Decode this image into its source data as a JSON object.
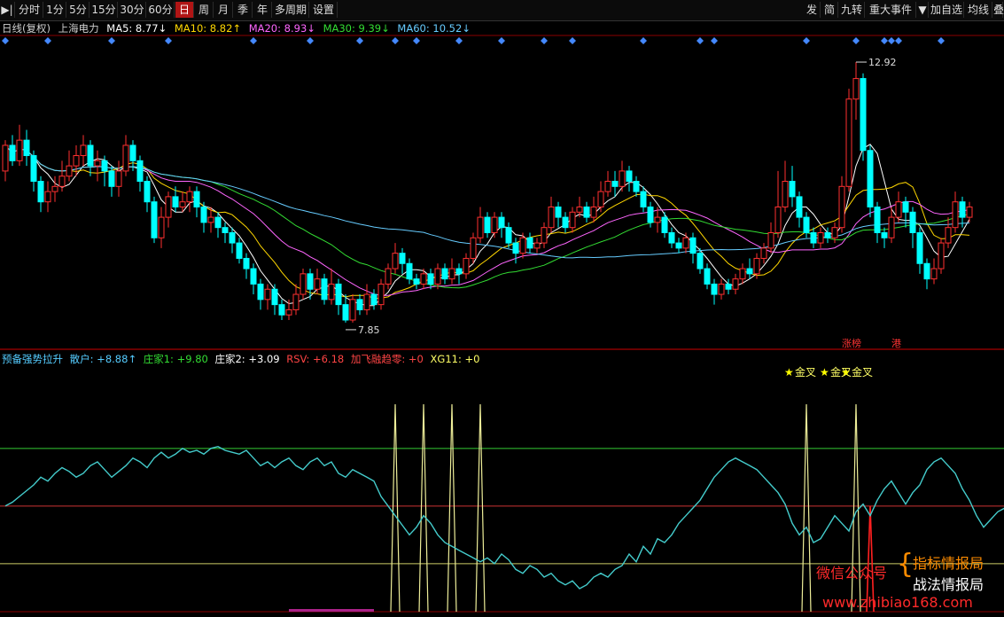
{
  "toolbar": {
    "left": [
      {
        "label": "▶|",
        "active": false
      },
      {
        "label": "分时",
        "active": false
      },
      {
        "label": "1分",
        "active": false
      },
      {
        "label": "5分",
        "active": false
      },
      {
        "label": "15分",
        "active": false
      },
      {
        "label": "30分",
        "active": false
      },
      {
        "label": "60分",
        "active": false
      },
      {
        "label": "日",
        "active": true
      },
      {
        "label": "周",
        "active": false
      },
      {
        "label": "月",
        "active": false
      },
      {
        "label": "季",
        "active": false
      },
      {
        "label": "年",
        "active": false
      },
      {
        "label": "多周期",
        "active": false
      },
      {
        "label": "设置",
        "active": false
      }
    ],
    "right": [
      "发",
      "简",
      "九转",
      "重大事件",
      "▼",
      "加自选",
      "均线",
      "叠"
    ]
  },
  "info": {
    "period": "日线(复权)",
    "stock": "上海电力",
    "ma5": {
      "label": "MA5: 8.77",
      "arrow": "↓",
      "color": "#ffffff"
    },
    "ma10": {
      "label": "MA10: 8.82",
      "arrow": "↑",
      "color": "#ffd700"
    },
    "ma20": {
      "label": "MA20: 8.93",
      "arrow": "↓",
      "color": "#ff66ff"
    },
    "ma30": {
      "label": "MA30: 9.39",
      "arrow": "↓",
      "color": "#33dd33"
    },
    "ma60": {
      "label": "MA60: 10.52",
      "arrow": "↓",
      "color": "#66ccff"
    }
  },
  "indicator": {
    "name": "预备强势拉升",
    "items": [
      {
        "label": "散户: +8.88",
        "arrow": "↑",
        "color": "#55ccff"
      },
      {
        "label": "庄家1: +9.80",
        "arrow": "",
        "color": "#33dd33"
      },
      {
        "label": "庄家2: +3.09",
        "arrow": "",
        "color": "#ffffff"
      },
      {
        "label": "RSV: +6.18",
        "arrow": "",
        "color": "#ff4444"
      },
      {
        "label": "加飞融趋零: +0",
        "arrow": "",
        "color": "#ff4444"
      },
      {
        "label": "XG11: +0",
        "arrow": "",
        "color": "#ffff66"
      }
    ],
    "signal_label": "金叉"
  },
  "colors": {
    "up": "#ff3030",
    "down": "#00ffff",
    "grid": "#8b0000",
    "marker": "#4488ff"
  },
  "chart_data": {
    "type": "candlestick",
    "price_range": [
      7.4,
      13.3
    ],
    "candles": [
      [
        10.8,
        11.3,
        11.4,
        10.6
      ],
      [
        11.3,
        11.0,
        11.5,
        10.9
      ],
      [
        11.0,
        11.4,
        11.7,
        10.9
      ],
      [
        11.4,
        11.1,
        11.6,
        10.9
      ],
      [
        11.1,
        10.6,
        11.2,
        10.4
      ],
      [
        10.6,
        10.2,
        10.7,
        10.0
      ],
      [
        10.2,
        10.4,
        10.6,
        10.0
      ],
      [
        10.4,
        10.5,
        10.7,
        10.2
      ],
      [
        10.5,
        10.7,
        11.0,
        10.4
      ],
      [
        10.7,
        10.9,
        11.2,
        10.6
      ],
      [
        10.9,
        11.1,
        11.3,
        10.7
      ],
      [
        11.1,
        11.3,
        11.5,
        10.9
      ],
      [
        11.3,
        10.9,
        11.4,
        10.7
      ],
      [
        10.9,
        11.0,
        11.2,
        10.6
      ],
      [
        11.0,
        10.8,
        11.1,
        10.5
      ],
      [
        10.8,
        10.5,
        10.9,
        10.3
      ],
      [
        10.5,
        10.8,
        11.0,
        10.3
      ],
      [
        10.8,
        11.3,
        11.5,
        10.7
      ],
      [
        11.3,
        11.0,
        11.4,
        10.8
      ],
      [
        11.0,
        10.6,
        11.1,
        10.4
      ],
      [
        10.6,
        10.2,
        10.7,
        10.0
      ],
      [
        10.2,
        9.5,
        10.3,
        9.4
      ],
      [
        9.5,
        9.9,
        10.1,
        9.3
      ],
      [
        9.9,
        10.3,
        10.4,
        9.7
      ],
      [
        10.3,
        10.1,
        10.5,
        10.0
      ],
      [
        10.1,
        10.2,
        10.4,
        10.0
      ],
      [
        10.2,
        10.4,
        10.5,
        10.0
      ],
      [
        10.4,
        10.1,
        10.5,
        9.9
      ],
      [
        10.1,
        9.8,
        10.2,
        9.6
      ],
      [
        9.8,
        9.9,
        10.1,
        9.6
      ],
      [
        9.9,
        9.7,
        10.0,
        9.5
      ],
      [
        9.7,
        9.6,
        9.8,
        9.4
      ],
      [
        9.6,
        9.4,
        9.7,
        9.2
      ],
      [
        9.4,
        9.1,
        9.5,
        9.0
      ],
      [
        9.1,
        8.9,
        9.2,
        8.7
      ],
      [
        8.9,
        8.6,
        9.0,
        8.4
      ],
      [
        8.6,
        8.3,
        8.7,
        8.1
      ],
      [
        8.3,
        8.5,
        8.6,
        8.1
      ],
      [
        8.5,
        8.2,
        8.6,
        8.0
      ],
      [
        8.2,
        8.0,
        8.3,
        7.9
      ],
      [
        8.0,
        8.1,
        8.3,
        7.9
      ],
      [
        8.1,
        8.4,
        8.6,
        8.0
      ],
      [
        8.4,
        8.8,
        8.9,
        8.3
      ],
      [
        8.8,
        8.5,
        8.9,
        8.3
      ],
      [
        8.5,
        8.7,
        8.9,
        8.4
      ],
      [
        8.7,
        8.3,
        8.8,
        8.2
      ],
      [
        8.3,
        8.6,
        8.9,
        8.2
      ],
      [
        8.6,
        8.2,
        8.7,
        8.0
      ],
      [
        8.2,
        7.9,
        8.4,
        7.85
      ],
      [
        7.9,
        8.3,
        8.4,
        7.85
      ],
      [
        8.3,
        8.1,
        8.4,
        8.0
      ],
      [
        8.1,
        8.4,
        8.6,
        8.0
      ],
      [
        8.4,
        8.2,
        8.5,
        8.1
      ],
      [
        8.2,
        8.6,
        8.7,
        8.1
      ],
      [
        8.6,
        8.9,
        9.0,
        8.5
      ],
      [
        8.9,
        9.2,
        9.4,
        8.8
      ],
      [
        9.2,
        9.0,
        9.3,
        8.8
      ],
      [
        9.0,
        8.7,
        9.1,
        8.6
      ],
      [
        8.7,
        8.6,
        8.8,
        8.5
      ],
      [
        8.6,
        8.8,
        8.9,
        8.5
      ],
      [
        8.8,
        8.6,
        8.9,
        8.5
      ],
      [
        8.6,
        8.9,
        9.0,
        8.5
      ],
      [
        8.9,
        8.7,
        9.0,
        8.6
      ],
      [
        8.7,
        8.9,
        9.1,
        8.6
      ],
      [
        8.9,
        8.8,
        9.0,
        8.6
      ],
      [
        8.8,
        9.1,
        9.2,
        8.7
      ],
      [
        9.1,
        9.5,
        9.6,
        9.0
      ],
      [
        9.5,
        9.9,
        10.1,
        9.4
      ],
      [
        9.9,
        9.6,
        10.0,
        9.5
      ],
      [
        9.6,
        9.9,
        10.0,
        9.5
      ],
      [
        9.9,
        9.7,
        10.0,
        9.5
      ],
      [
        9.7,
        9.4,
        9.8,
        9.3
      ],
      [
        9.4,
        9.2,
        9.5,
        9.0
      ],
      [
        9.2,
        9.5,
        9.6,
        9.1
      ],
      [
        9.5,
        9.3,
        9.6,
        9.2
      ],
      [
        9.3,
        9.4,
        9.5,
        9.2
      ],
      [
        9.4,
        9.7,
        9.8,
        9.3
      ],
      [
        9.7,
        10.1,
        10.3,
        9.6
      ],
      [
        10.1,
        9.9,
        10.2,
        9.7
      ],
      [
        9.9,
        9.7,
        10.0,
        9.6
      ],
      [
        9.7,
        10.0,
        10.1,
        9.6
      ],
      [
        10.0,
        10.1,
        10.3,
        9.9
      ],
      [
        10.1,
        9.9,
        10.2,
        9.8
      ],
      [
        9.9,
        10.1,
        10.3,
        9.8
      ],
      [
        10.1,
        10.4,
        10.6,
        10.0
      ],
      [
        10.4,
        10.6,
        10.8,
        10.3
      ],
      [
        10.6,
        10.5,
        10.8,
        10.3
      ],
      [
        10.5,
        10.8,
        11.0,
        10.4
      ],
      [
        10.8,
        10.6,
        10.9,
        10.4
      ],
      [
        10.6,
        10.4,
        10.7,
        10.3
      ],
      [
        10.4,
        10.1,
        10.5,
        10.0
      ],
      [
        10.1,
        9.8,
        10.2,
        9.7
      ],
      [
        9.8,
        9.9,
        10.1,
        9.6
      ],
      [
        9.9,
        9.6,
        10.0,
        9.5
      ],
      [
        9.6,
        9.4,
        9.7,
        9.3
      ],
      [
        9.4,
        9.3,
        9.5,
        9.2
      ],
      [
        9.3,
        9.5,
        9.6,
        9.2
      ],
      [
        9.5,
        9.2,
        9.6,
        9.0
      ],
      [
        9.2,
        8.9,
        9.3,
        8.8
      ],
      [
        8.9,
        8.6,
        9.0,
        8.5
      ],
      [
        8.6,
        8.4,
        8.7,
        8.2
      ],
      [
        8.4,
        8.6,
        8.7,
        8.3
      ],
      [
        8.6,
        8.5,
        8.7,
        8.4
      ],
      [
        8.5,
        8.7,
        8.8,
        8.4
      ],
      [
        8.7,
        8.9,
        9.0,
        8.6
      ],
      [
        8.9,
        8.8,
        9.1,
        8.7
      ],
      [
        8.8,
        9.1,
        9.2,
        8.7
      ],
      [
        9.1,
        9.3,
        9.4,
        9.0
      ],
      [
        9.3,
        9.6,
        9.8,
        9.2
      ],
      [
        9.6,
        10.1,
        10.8,
        9.5
      ],
      [
        10.1,
        10.6,
        11.0,
        10.0
      ],
      [
        10.6,
        10.3,
        10.9,
        10.1
      ],
      [
        10.3,
        9.9,
        10.4,
        9.7
      ],
      [
        9.9,
        9.6,
        10.0,
        9.5
      ],
      [
        9.6,
        9.4,
        9.7,
        9.3
      ],
      [
        9.4,
        9.6,
        9.7,
        9.3
      ],
      [
        9.6,
        9.5,
        9.7,
        9.4
      ],
      [
        9.5,
        9.7,
        9.8,
        9.4
      ],
      [
        9.7,
        10.5,
        10.7,
        9.6
      ],
      [
        10.5,
        12.2,
        12.4,
        10.4
      ],
      [
        12.2,
        12.6,
        12.92,
        11.8
      ],
      [
        12.6,
        11.2,
        12.7,
        11.0
      ],
      [
        11.2,
        10.1,
        11.3,
        9.9
      ],
      [
        10.1,
        9.6,
        10.2,
        9.4
      ],
      [
        9.6,
        9.5,
        9.7,
        9.3
      ],
      [
        9.5,
        9.9,
        10.1,
        9.4
      ],
      [
        9.9,
        10.2,
        10.4,
        9.8
      ],
      [
        10.2,
        10.0,
        10.3,
        9.7
      ],
      [
        10.0,
        9.6,
        10.1,
        9.3
      ],
      [
        9.6,
        9.0,
        9.7,
        8.8
      ],
      [
        9.0,
        8.7,
        9.1,
        8.5
      ],
      [
        8.7,
        8.9,
        9.1,
        8.6
      ],
      [
        8.9,
        9.4,
        9.5,
        8.8
      ],
      [
        9.4,
        9.7,
        9.9,
        9.3
      ],
      [
        9.7,
        10.2,
        10.4,
        9.6
      ],
      [
        10.2,
        9.9,
        10.3,
        9.7
      ],
      [
        9.9,
        10.1,
        10.2,
        9.8
      ]
    ],
    "extremes": {
      "high": "12.92",
      "low": "7.85"
    },
    "signal_days": [
      110,
      115,
      118
    ],
    "indicator_range": [
      0,
      120
    ],
    "levels": [
      {
        "value": 85,
        "color": "#33cc33"
      },
      {
        "value": 55,
        "color": "#cc3333"
      },
      {
        "value": 25,
        "color": "#cccc66"
      }
    ],
    "retail_line": [
      55,
      57,
      60,
      63,
      66,
      70,
      68,
      72,
      75,
      73,
      70,
      72,
      76,
      78,
      74,
      70,
      73,
      76,
      80,
      78,
      75,
      80,
      83,
      80,
      82,
      85,
      83,
      84,
      82,
      85,
      86,
      84,
      83,
      82,
      84,
      80,
      76,
      78,
      75,
      78,
      80,
      76,
      74,
      78,
      80,
      76,
      78,
      72,
      70,
      74,
      72,
      70,
      68,
      60,
      55,
      50,
      45,
      40,
      44,
      50,
      46,
      40,
      36,
      34,
      32,
      30,
      28,
      26,
      28,
      25,
      30,
      27,
      22,
      20,
      24,
      22,
      18,
      20,
      16,
      14,
      16,
      12,
      14,
      18,
      20,
      18,
      22,
      24,
      30,
      26,
      34,
      30,
      38,
      36,
      40,
      46,
      50,
      54,
      58,
      64,
      70,
      74,
      78,
      80,
      78,
      76,
      74,
      70,
      66,
      62,
      56,
      46,
      40,
      44,
      36,
      38,
      44,
      50,
      46,
      42,
      52,
      56,
      50,
      58,
      64,
      68,
      62,
      56,
      62,
      66,
      74,
      78,
      80,
      76,
      72,
      64,
      58,
      50,
      44,
      48,
      52,
      54,
      56
    ],
    "spikes": [
      {
        "i": 55,
        "h": 108
      },
      {
        "i": 59,
        "h": 108
      },
      {
        "i": 63,
        "h": 108
      },
      {
        "i": 67,
        "h": 108
      },
      {
        "i": 113,
        "h": 108
      },
      {
        "i": 120,
        "h": 108
      }
    ],
    "red_spike": {
      "i": 122,
      "h": 55
    }
  },
  "markers_top": [
    {
      "i": 0
    },
    {
      "i": 6
    },
    {
      "i": 15
    },
    {
      "i": 23
    },
    {
      "i": 35
    },
    {
      "i": 43
    },
    {
      "i": 50
    },
    {
      "i": 55
    },
    {
      "i": 58
    },
    {
      "i": 64
    },
    {
      "i": 70
    },
    {
      "i": 76
    },
    {
      "i": 80
    },
    {
      "i": 90
    },
    {
      "i": 98
    },
    {
      "i": 100
    },
    {
      "i": 113
    },
    {
      "i": 120
    },
    {
      "i": 124
    },
    {
      "i": 125
    },
    {
      "i": 126
    },
    {
      "i": 132
    }
  ],
  "tags": {
    "tag1": "涨榜",
    "tag2": "港"
  },
  "watermark": {
    "line1": "微信公众号",
    "line2a": "指标情报局",
    "line2b": "战法情报局",
    "url": "www.zhibiao168.com"
  }
}
